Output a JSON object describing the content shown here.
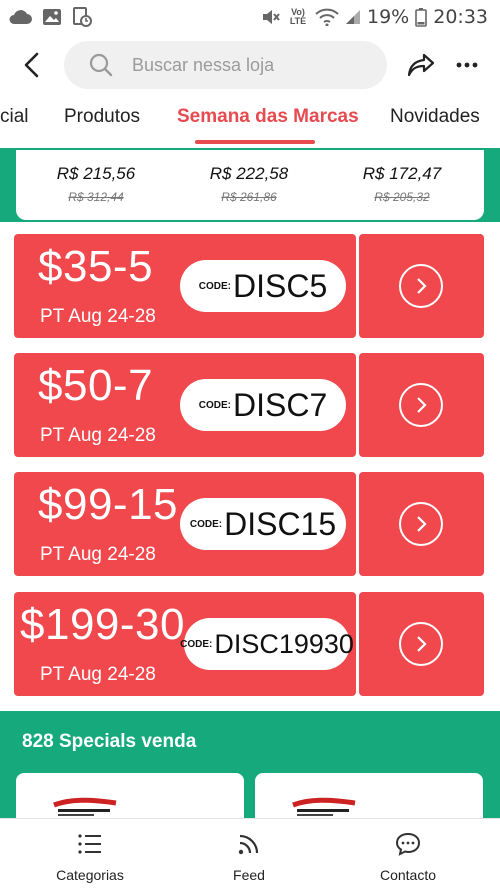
{
  "status_bar": {
    "icons": [
      "cloud-icon",
      "image-icon",
      "doc-sync-icon",
      "mute-icon",
      "volte-icon",
      "wifi-icon",
      "signal-icon",
      "battery-icon"
    ],
    "volte_label": "Vo) LTE",
    "battery": "19%",
    "time": "20:33"
  },
  "header": {
    "search_placeholder": "Buscar nessa loja"
  },
  "tabs": [
    {
      "label": "cial"
    },
    {
      "label": "Produtos"
    },
    {
      "label": "Semana das Marcas",
      "active": true
    },
    {
      "label": "Novidades"
    }
  ],
  "prices": [
    {
      "now": "R$ 215,56",
      "old": "R$ 312,44"
    },
    {
      "now": "R$ 222,58",
      "old": "R$ 261,86"
    },
    {
      "now": "R$ 172,47",
      "old": "R$ 205,32"
    }
  ],
  "coupons": [
    {
      "amount": "$35-5",
      "period": "PT Aug 24-28",
      "code_label": "CODE:",
      "code": "DISC5"
    },
    {
      "amount": "$50-7",
      "period": "PT Aug 24-28",
      "code_label": "CODE:",
      "code": "DISC7"
    },
    {
      "amount": "$99-15",
      "period": "PT Aug 24-28",
      "code_label": "CODE:",
      "code": "DISC15"
    },
    {
      "amount": "$199-30",
      "period": "PT Aug 24-28",
      "code_label": "CODE:",
      "code": "DISC19930"
    }
  ],
  "specials": {
    "title": "828 Specials venda"
  },
  "bottom_nav": [
    {
      "label": "Categorias",
      "icon": "list-icon"
    },
    {
      "label": "Feed",
      "icon": "feed-icon"
    },
    {
      "label": "Contacto",
      "icon": "chat-icon"
    }
  ],
  "colors": {
    "accent_red": "#f0484c",
    "tab_active": "#e74a4f",
    "green": "#15a97b"
  }
}
